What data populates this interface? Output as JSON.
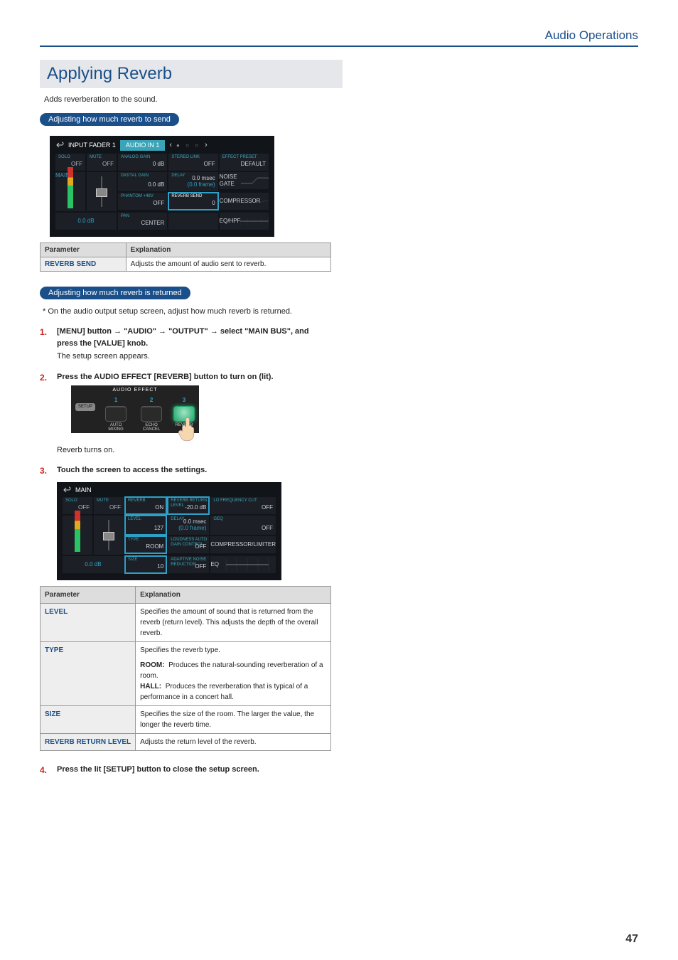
{
  "header": {
    "section": "Audio Operations"
  },
  "title": "Applying Reverb",
  "intro": "Adds reverberation to the sound.",
  "pills": {
    "send": "Adjusting how much reverb to send",
    "return": "Adjusting how much reverb is returned"
  },
  "tables": {
    "send": {
      "headers": [
        "Parameter",
        "Explanation"
      ],
      "rows": [
        {
          "name": "REVERB SEND",
          "expl": "Adjusts the amount of audio sent to reverb."
        }
      ]
    },
    "return": {
      "headers": [
        "Parameter",
        "Explanation"
      ],
      "rows": [
        {
          "name": "LEVEL",
          "expl": "Specifies the amount of sound that is returned from the reverb (return level). This adjusts the depth of the overall reverb."
        },
        {
          "name": "TYPE",
          "intro": "Specifies the reverb type.",
          "room_label": "ROOM:",
          "room_text": "Produces the natural-sounding reverberation of a room.",
          "hall_label": "HALL:",
          "hall_text": "Produces the reverberation that is typical of a performance in a concert hall."
        },
        {
          "name": "SIZE",
          "expl": "Specifies the size of the room. The larger the value, the longer the reverb time."
        },
        {
          "name": "REVERB RETURN LEVEL",
          "expl": "Adjusts the return level of the reverb."
        }
      ]
    }
  },
  "return_note": "On the audio output setup screen, adjust how much reverb is returned.",
  "steps": {
    "s1": {
      "main_pre": "[MENU] button ",
      "main_post": " select \"MAIN BUS\", and press the [VALUE] knob.",
      "segments": [
        "\"AUDIO\"",
        "\"OUTPUT\""
      ],
      "body": "The setup screen appears."
    },
    "s2": {
      "main": "Press the AUDIO EFFECT [REVERB] button to turn on (lit).",
      "body": "Reverb turns on."
    },
    "s3": {
      "main": "Touch the screen to access the settings."
    },
    "s4": {
      "main": "Press the lit [SETUP] button to close the setup screen."
    }
  },
  "mock1": {
    "bar_title": "INPUT FADER 1",
    "accent": "AUDIO IN 1",
    "row1": {
      "solo_lbl": "SOLO",
      "mute_lbl": "MUTE",
      "ag_lbl": "ANALOG GAIN",
      "sl_lbl": "STEREO LINK",
      "ep_lbl": "EFFECT PRESET"
    },
    "row1v": {
      "solo": "OFF",
      "mute": "OFF",
      "ag": "0 dB",
      "sl": "OFF",
      "ep": "DEFAULT"
    },
    "row2": {
      "main_lbl": "MAIN",
      "dg_lbl": "DIGITAL GAIN",
      "dl_lbl": "DELAY",
      "ng_lbl": "NOISE GATE"
    },
    "row2v": {
      "dg": "0.0 dB",
      "dl_a": "0.0 msec",
      "dl_b": "(0.0 frame)"
    },
    "row3": {
      "p48_lbl": "PHANTOM +48V",
      "rs_lbl": "REVERB SEND",
      "cmp_lbl": "COMPRESSOR"
    },
    "row3v": {
      "p48": "OFF",
      "rs": "0"
    },
    "row4": {
      "pan_lbl": "PAN",
      "eq_lbl": "EQ/HPF"
    },
    "row4v": {
      "level": "0.0 dB",
      "pan": "CENTER"
    }
  },
  "mock2": {
    "ae_title": "AUDIO EFFECT",
    "nums": [
      "1",
      "2",
      "3"
    ],
    "setup": "SETUP",
    "auto_mix": "AUTO\nMIXING",
    "echo": "ECHO\nCANCEL",
    "reverb": "REVERB"
  },
  "mock3": {
    "bar_title": "MAIN",
    "row1": {
      "solo_lbl": "SOLO",
      "mute_lbl": "MUTE",
      "rv_lbl": "REVERB",
      "rl_lbl": "REVERB\nRETURN LEVEL",
      "lf_lbl": "LO FREQUENCY CUT"
    },
    "row1v": {
      "solo": "OFF",
      "mute": "OFF",
      "rv": "ON",
      "rl": "-20.0 dB",
      "lf": "OFF"
    },
    "row2": {
      "lvl_lbl": "LEVEL",
      "dl_lbl": "DELAY",
      "geq_lbl": "GEQ"
    },
    "row2v": {
      "lvl": "127",
      "dl_a": "0.0 msec",
      "dl_b": "(0.0 frame)",
      "geq": "OFF"
    },
    "row3": {
      "type_lbl": "TYPE",
      "agc_lbl": "LOUDNESS AUTO\nGAIN CONTROL",
      "cl_lbl": "COMPRESSOR/LIMITER"
    },
    "row3v": {
      "type": "ROOM",
      "agc": "OFF"
    },
    "row4": {
      "size_lbl": "SIZE",
      "anr_lbl": "ADAPTIVE\nNOISE REDUCTION",
      "eq_lbl": "EQ"
    },
    "row4v": {
      "lvl": "0.0 dB",
      "size": "10",
      "anr": "OFF"
    }
  },
  "page_number": "47"
}
